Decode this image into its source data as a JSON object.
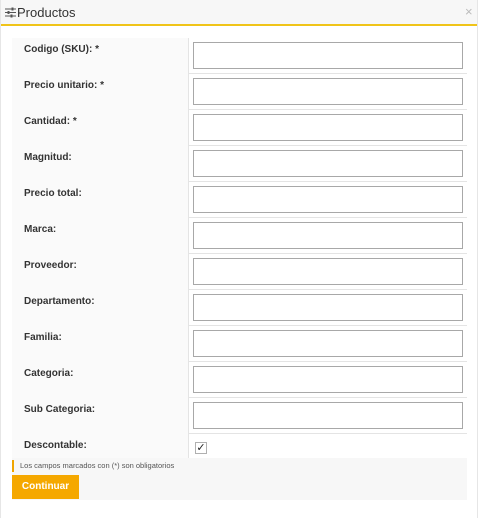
{
  "dialog": {
    "title": "Productos",
    "close_label": "×"
  },
  "form": {
    "fields": [
      {
        "label": "Codigo (SKU): *",
        "value": ""
      },
      {
        "label": "Precio unitario: *",
        "value": ""
      },
      {
        "label": "Cantidad: *",
        "value": ""
      },
      {
        "label": "Magnitud:",
        "value": ""
      },
      {
        "label": "Precio total:",
        "value": ""
      },
      {
        "label": "Marca:",
        "value": ""
      },
      {
        "label": "Proveedor:",
        "value": ""
      },
      {
        "label": "Departamento:",
        "value": ""
      },
      {
        "label": "Familia:",
        "value": ""
      },
      {
        "label": "Categoria:",
        "value": ""
      },
      {
        "label": "Sub Categoria:",
        "value": ""
      }
    ],
    "descontable": {
      "label": "Descontable:",
      "checked": true,
      "mark": "✓"
    }
  },
  "footer": {
    "note": "Los campos marcados con (*) son obligatorios",
    "continue_label": "Continuar"
  },
  "colors": {
    "accent": "#f5a800",
    "title_underline": "#f0c419"
  }
}
